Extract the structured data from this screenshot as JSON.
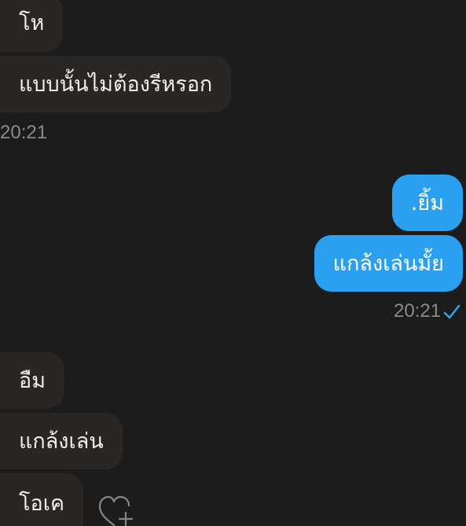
{
  "colors": {
    "background": "#1c1c1c",
    "incoming_bubble": "#2a2624",
    "outgoing_bubble": "#2ba0f0",
    "timestamp": "#8e8a86",
    "read_check": "#2ba0f0"
  },
  "messages_top_incoming": [
    {
      "text": "โห"
    },
    {
      "text": "แบบนั้นไม่ต้องรีหรอก"
    }
  ],
  "timestamp_incoming_1": "20:21",
  "messages_outgoing": [
    {
      "text": ".ยิ้ม"
    },
    {
      "text": "แกล้งเล่นมั้ย"
    }
  ],
  "timestamp_outgoing": "20:21",
  "status_icon": "check-icon",
  "messages_bottom_incoming": [
    {
      "text": "อืม"
    },
    {
      "text": "แกล้งเล่น"
    },
    {
      "text": "โอเค"
    }
  ],
  "reaction_icon": "heart-add-icon"
}
